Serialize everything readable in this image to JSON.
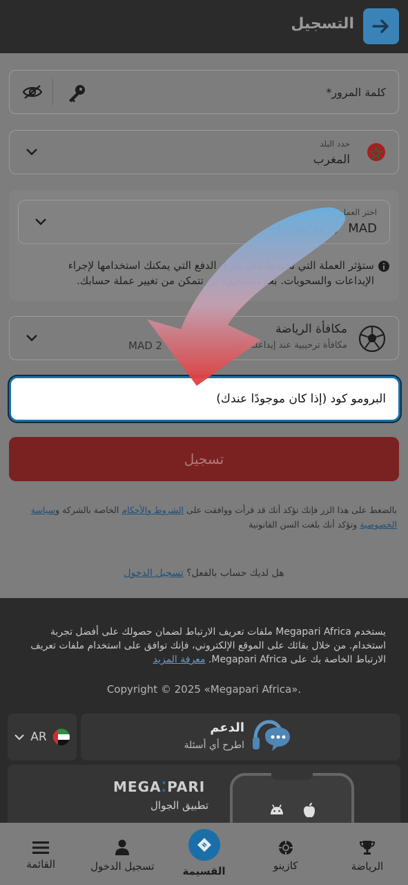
{
  "header": {
    "title": "التسجيل"
  },
  "password": {
    "label": "كلمة المرور*"
  },
  "country": {
    "caption": "حدد البلد",
    "value": "المغرب"
  },
  "currency": {
    "caption": "اختر العملة",
    "code": "MAD",
    "name": "(درهم مغربي)",
    "note": "ستؤثر العملة التي تحددها على طرق الدفع التي يمكنك استخدامها لإجراء الإيداعات والسحوبات. بعد التسجيل، لن تتمكن من تغيير عملة حسابك."
  },
  "bonus": {
    "title": "مكافأة الرياضة",
    "subtitle": "مكافأة ترحيبية عند إيداعك الأول",
    "amount": "MAD 2"
  },
  "promo": {
    "placeholder": "البرومو كود (إذا كان موجودًا عندك)"
  },
  "register_button": "تسجيل",
  "terms": {
    "prefix": "بالضغط على هذا الزر فإنك تؤكد أنك قد قرأت ووافقت على",
    "terms_link": "الشروط والأحكام",
    "middle": "الخاصة بالشركة و",
    "privacy_link": "سياسة الخصوصية",
    "suffix": "وتؤكد أنك بلغت السن القانونية"
  },
  "have_account": {
    "text": "هل لديك حساب بالفعل؟",
    "link": "تسجيل الدخول"
  },
  "cookie": {
    "text": "يستخدم Megapari Africa ملفات تعريف الارتباط لضمان حصولك على أفضل تجربة استخدام. من خلال بقائك على الموقع الإلكتروني، فإنك توافق على استخدام ملفات تعريف الارتباط الخاصة بك على Megapari Africa.",
    "link": "معرفة المزيد"
  },
  "copyright": "Copyright © 2025 «Megapari Africa».",
  "language": {
    "code": "AR"
  },
  "support": {
    "title": "الدعم",
    "subtitle": "اطرح أي أسئلة"
  },
  "app": {
    "brand_left": "MEGA",
    "brand_right": "PARI",
    "label": "تطبيق الجوال"
  },
  "nav": [
    {
      "label": "الرياضة",
      "icon": "trophy-icon"
    },
    {
      "label": "كازينو",
      "icon": "casino-chip-icon"
    },
    {
      "label": "القسيمة",
      "icon": "ticket-icon"
    },
    {
      "label": "تسجيل الدخول",
      "icon": "user-icon"
    },
    {
      "label": "القائمة",
      "icon": "menu-icon"
    }
  ],
  "colors": {
    "accent": "#1b6fa8",
    "register": "#7a2222",
    "overlay": "#7d7d7d"
  }
}
